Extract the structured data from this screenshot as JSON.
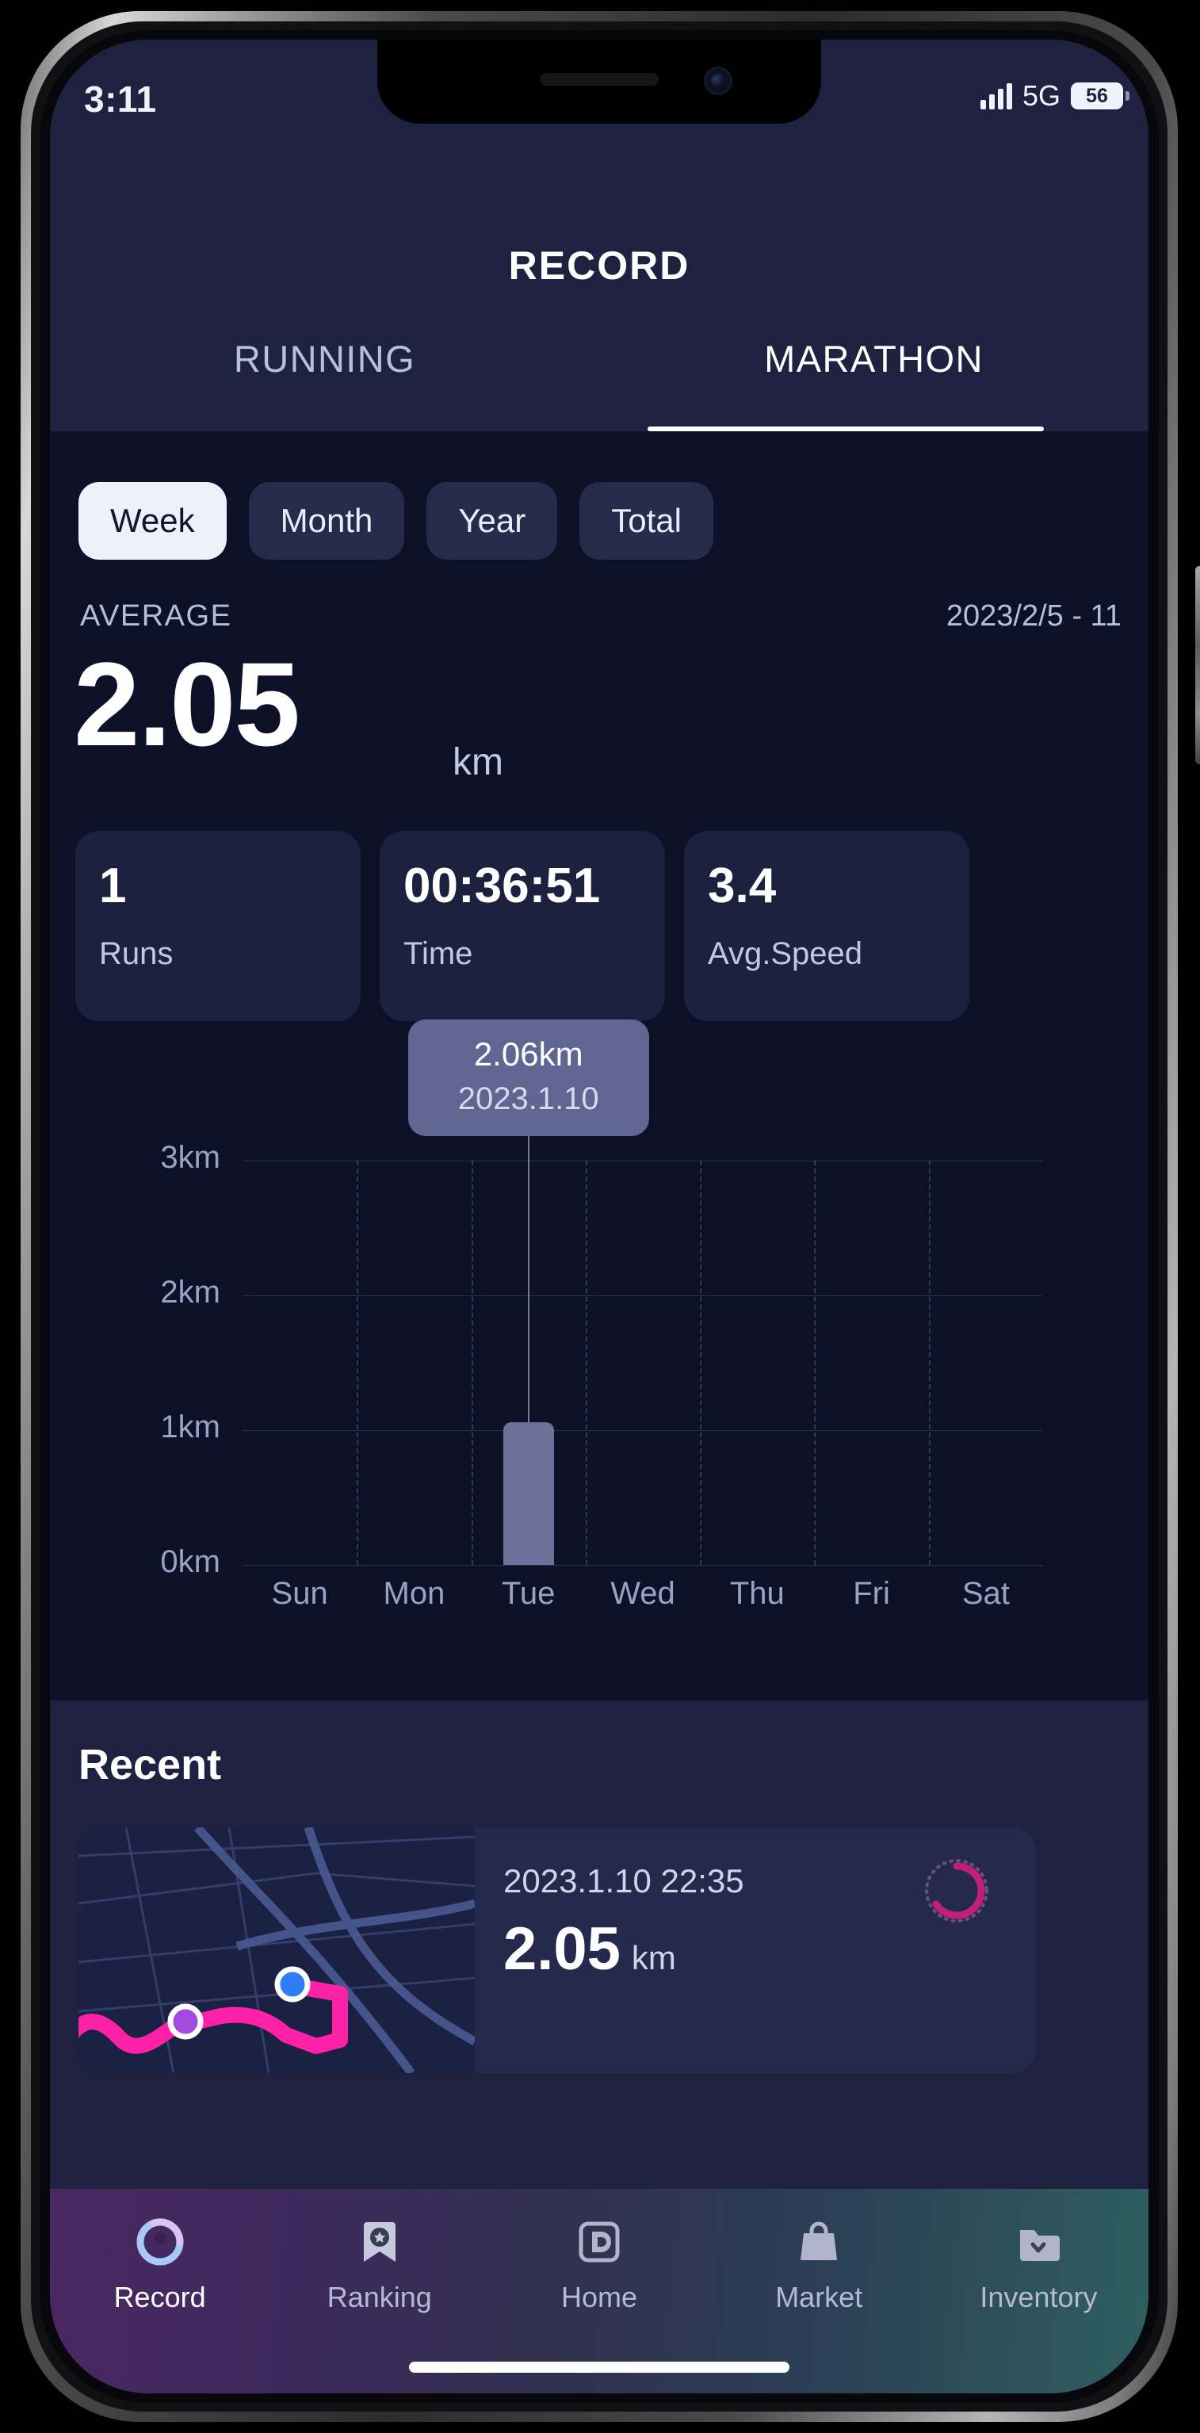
{
  "status_bar": {
    "time": "3:11",
    "network": "5G",
    "battery": "56",
    "signal_icon": "signal-bars-icon",
    "battery_icon": "battery-icon"
  },
  "header": {
    "title": "RECORD",
    "tabs": [
      {
        "label": "RUNNING",
        "active": false
      },
      {
        "label": "MARATHON",
        "active": true
      }
    ]
  },
  "filters": [
    {
      "label": "Week",
      "active": true
    },
    {
      "label": "Month",
      "active": false
    },
    {
      "label": "Year",
      "active": false
    },
    {
      "label": "Total",
      "active": false
    }
  ],
  "summary": {
    "label": "AVERAGE",
    "date_range": "2023/2/5 - 11",
    "value": "2.05",
    "unit": "km",
    "cards": [
      {
        "value": "1",
        "label": "Runs"
      },
      {
        "value": "00:36:51",
        "label": "Time"
      },
      {
        "value": "3.4",
        "label": "Avg.Speed"
      }
    ]
  },
  "tooltip": {
    "value": "2.06km",
    "date": "2023.1.10"
  },
  "chart_data": {
    "type": "bar",
    "title": "",
    "xlabel": "",
    "ylabel": "km",
    "categories": [
      "Sun",
      "Mon",
      "Tue",
      "Wed",
      "Thu",
      "Fri",
      "Sat"
    ],
    "values": [
      0,
      0,
      1.06,
      0,
      0,
      0,
      0
    ],
    "ytick_labels": [
      "3km",
      "2km",
      "1km",
      "0km"
    ],
    "yticks": [
      3,
      2,
      1,
      0
    ],
    "ylim": [
      0,
      3
    ],
    "grid": true,
    "legend": "none",
    "selected_index": 2,
    "annotation": {
      "value": "2.06km",
      "date": "2023.1.10"
    },
    "bar_color": "#6b7199"
  },
  "recent": {
    "title": "Recent",
    "items": [
      {
        "date": "2023.1.10 22:35",
        "distance": "2.05",
        "unit": "km",
        "map_icon": "route-map-thumbnail",
        "progress_icon": "progress-ring-icon"
      }
    ]
  },
  "bottom_nav": [
    {
      "label": "Record",
      "icon": "record-icon",
      "active": true
    },
    {
      "label": "Ranking",
      "icon": "ranking-badge-icon",
      "active": false
    },
    {
      "label": "Home",
      "icon": "home-d-icon",
      "active": false
    },
    {
      "label": "Market",
      "icon": "market-bag-icon",
      "active": false
    },
    {
      "label": "Inventory",
      "icon": "inventory-box-icon",
      "active": false
    }
  ],
  "colors": {
    "header_bg": "#1e2240",
    "panel_bg": "#0d1128",
    "accent": "#ff21a8",
    "card_bg": "#1c2140",
    "bar": "#6b7199"
  }
}
